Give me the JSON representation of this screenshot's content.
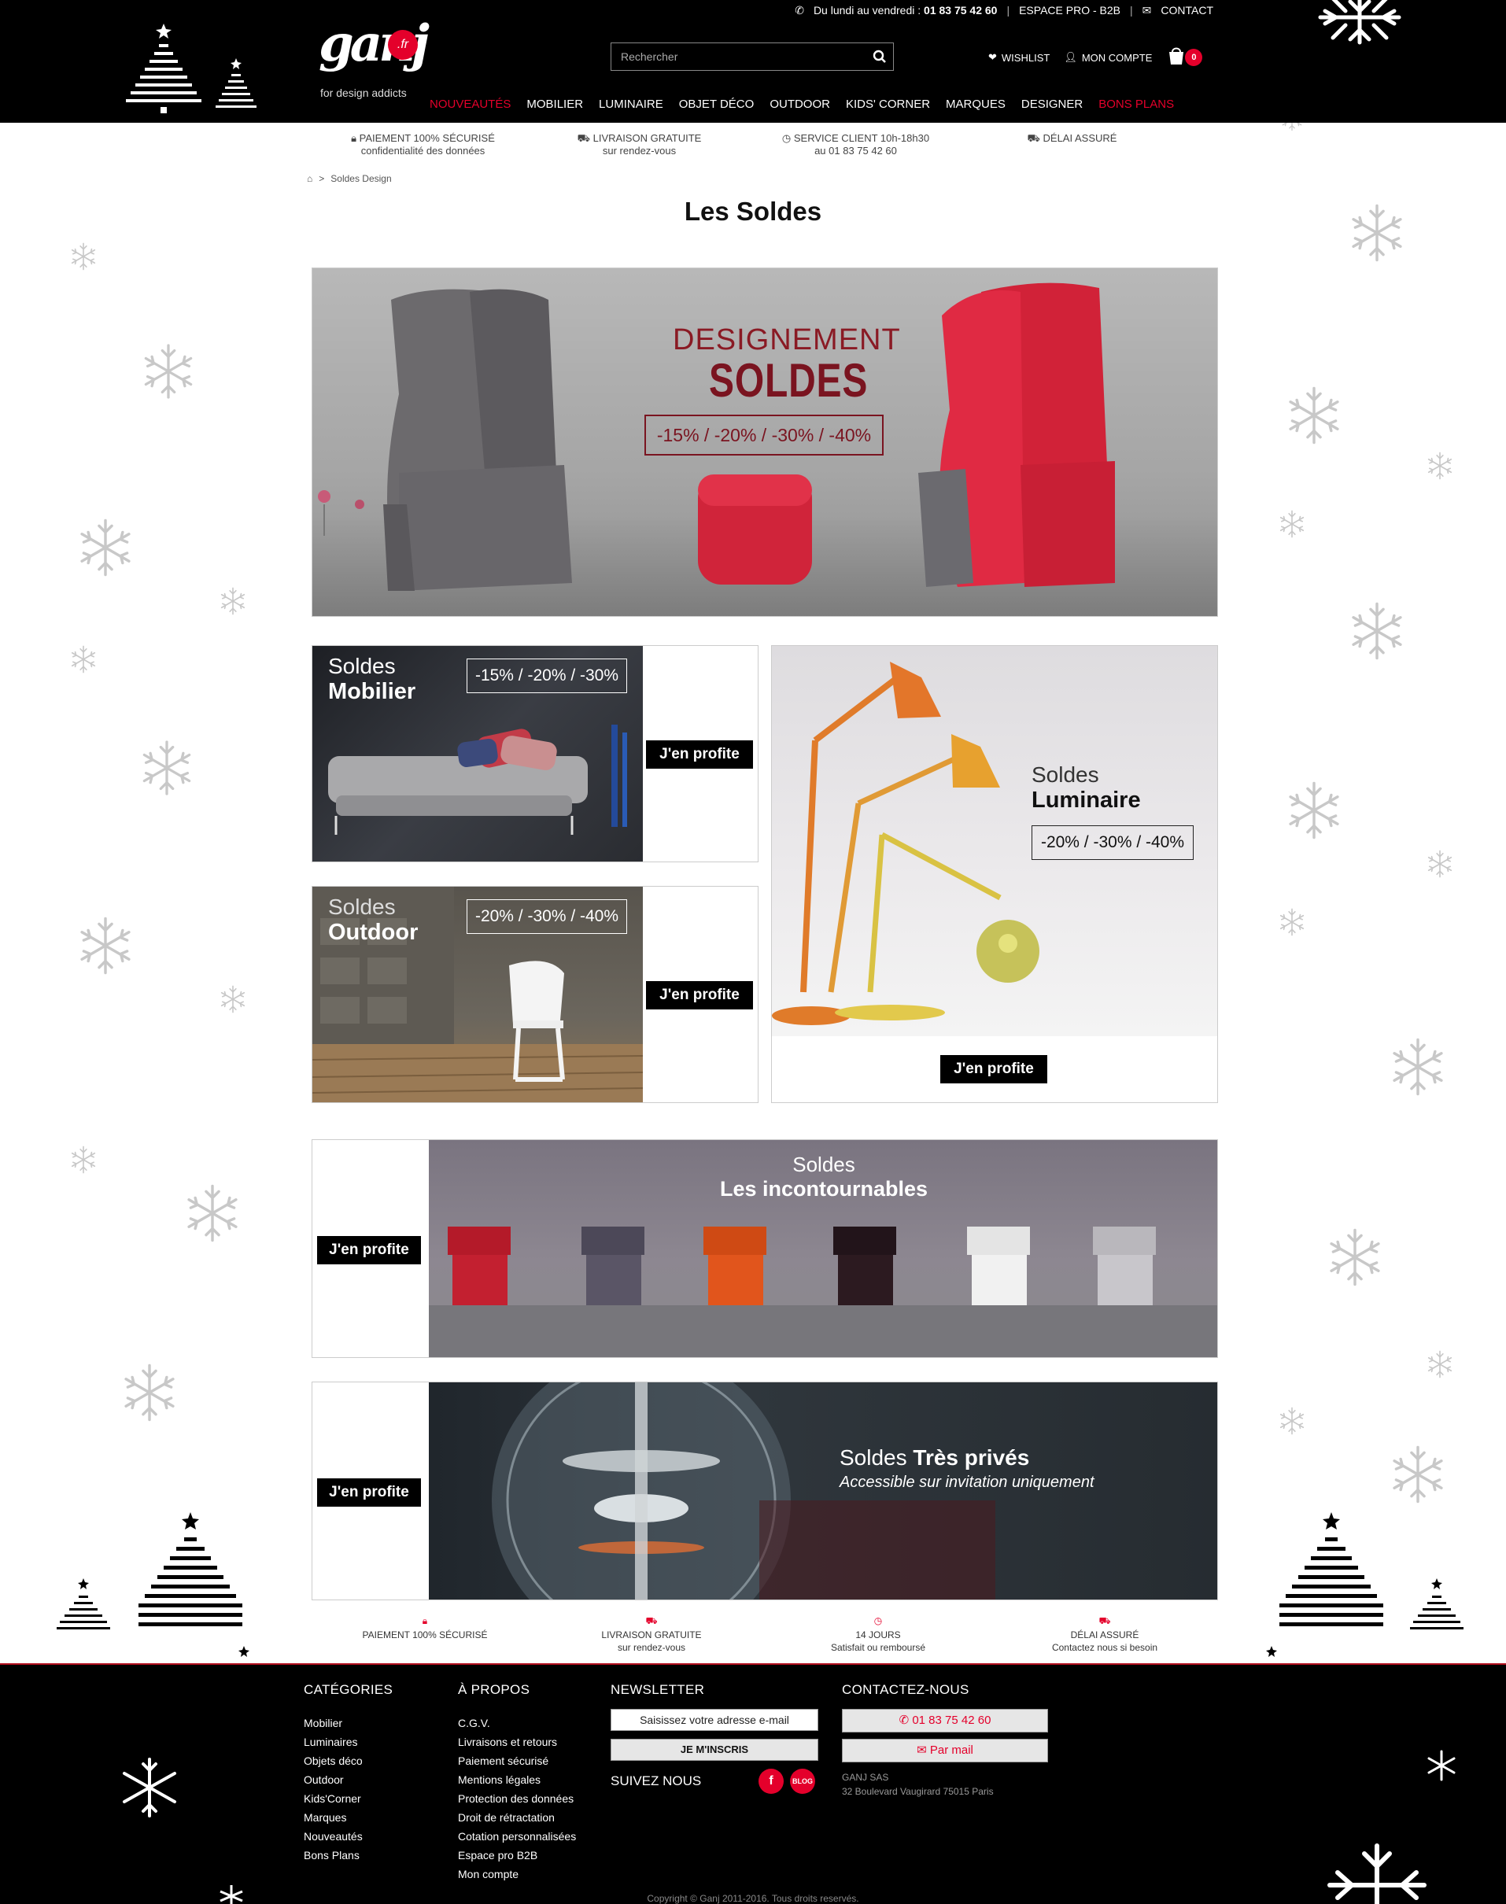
{
  "topbar": {
    "hours_prefix": "Du lundi au vendredi :",
    "phone": "01 83 75 42 60",
    "pro_link": "ESPACE PRO - B2B",
    "contact_link": "CONTACT"
  },
  "brand": {
    "name": "ganj",
    "badge": ".fr",
    "tagline": "for design addicts",
    "accent_color": "#e4002b"
  },
  "search": {
    "placeholder": "Rechercher"
  },
  "user": {
    "wishlist": "WISHLIST",
    "account": "MON COMPTE",
    "cart_count": "0"
  },
  "nav": [
    {
      "label": "NOUVEAUTÉS",
      "highlight": true
    },
    {
      "label": "MOBILIER",
      "highlight": false
    },
    {
      "label": "LUMINAIRE",
      "highlight": false
    },
    {
      "label": "OBJET DÉCO",
      "highlight": false
    },
    {
      "label": "OUTDOOR",
      "highlight": false
    },
    {
      "label": "KIDS' CORNER",
      "highlight": false
    },
    {
      "label": "MARQUES",
      "highlight": false
    },
    {
      "label": "DESIGNER",
      "highlight": false
    },
    {
      "label": "BONS PLANS",
      "highlight": true
    }
  ],
  "reassurance": [
    {
      "title": "PAIEMENT 100% SÉCURISÉ",
      "sub": "confidentialité des données",
      "icon": "lock-icon"
    },
    {
      "title": "LIVRAISON GRATUITE",
      "sub": "sur rendez-vous",
      "icon": "truck-icon"
    },
    {
      "title": "SERVICE CLIENT 10h-18h30",
      "sub": "au 01 83 75 42 60",
      "icon": "clock-icon"
    },
    {
      "title": "DÉLAI ASSURÉ",
      "sub": "",
      "icon": "truck-icon"
    }
  ],
  "breadcrumb": {
    "current": "Soldes Design"
  },
  "page": {
    "title": "Les Soldes"
  },
  "hero": {
    "line1": "DESIGNEMENT",
    "line2": "SOLDES",
    "discounts": "-15% / -20% / -30% / -40%"
  },
  "tiles": {
    "mobilier": {
      "l1": "Soldes",
      "l2": "Mobilier",
      "discounts": "-15% / -20% / -30%",
      "cta": "J'en profite"
    },
    "outdoor": {
      "l1": "Soldes",
      "l2": "Outdoor",
      "discounts": "-20% / -30% / -40%",
      "cta": "J'en profite"
    },
    "luminaire": {
      "l1": "Soldes",
      "l2": "Luminaire",
      "discounts": "-20% / -30% / -40%",
      "cta": "J'en profite"
    },
    "incontournables": {
      "l1": "Soldes",
      "l2": "Les incontournables",
      "cta": "J'en profite"
    },
    "prives": {
      "l1": "Soldes",
      "l2": "Très privés",
      "sub": "Accessible sur invitation uniquement",
      "cta": "J'en profite"
    }
  },
  "footer_reassurance": [
    {
      "title": "PAIEMENT 100% SÉCURISÉ",
      "sub": "",
      "icon": "lock-icon"
    },
    {
      "title": "LIVRAISON GRATUITE",
      "sub": "sur rendez-vous",
      "icon": "truck-icon"
    },
    {
      "title": "14 JOURS",
      "sub": "Satisfait ou remboursé",
      "icon": "clock-icon"
    },
    {
      "title": "DÉLAI ASSURÉ",
      "sub": "Contactez nous si besoin",
      "icon": "truck-icon"
    }
  ],
  "footer": {
    "categories_title": "CATÉGORIES",
    "categories": [
      "Mobilier",
      "Luminaires",
      "Objets déco",
      "Outdoor",
      "Kids'Corner",
      "Marques",
      "Nouveautés",
      "Bons Plans"
    ],
    "about_title": "À PROPOS",
    "about": [
      "C.G.V.",
      "Livraisons et retours",
      "Paiement sécurisé",
      "Mentions légales",
      "Protection des données",
      "Droit de rétractation",
      "Cotation personnalisées",
      "Espace pro B2B",
      "Mon compte"
    ],
    "newsletter_title": "NEWSLETTER",
    "newsletter_placeholder": "Saisissez votre adresse e-mail",
    "newsletter_button": "JE M'INSCRIS",
    "follow": "SUIVEZ NOUS",
    "social_fb": "f",
    "social_blog": "BLOG",
    "contact_title": "CONTACTEZ-NOUS",
    "contact_phone": "01 83 75 42 60",
    "contact_mail": "Par mail",
    "company_name": "GANJ SAS",
    "company_address": "32 Boulevard Vaugirard 75015 Paris",
    "copyright": "Copyright © Ganj 2011-2016. Tous droits reservés."
  }
}
